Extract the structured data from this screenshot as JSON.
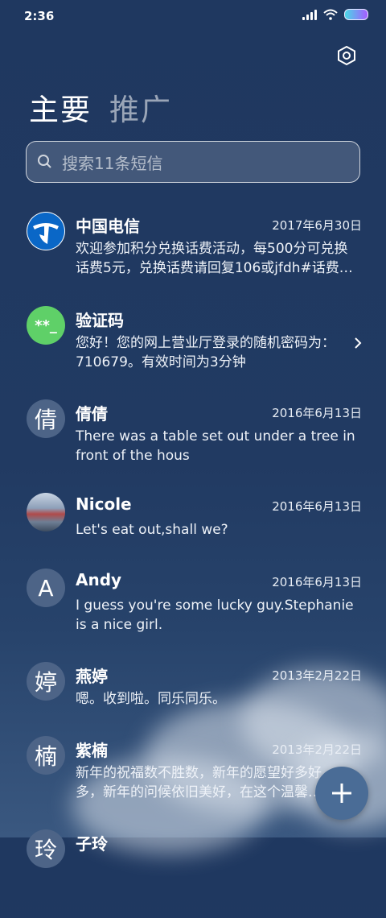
{
  "status": {
    "time": "2:36"
  },
  "tabs": {
    "primary": "主要",
    "promotions": "推广"
  },
  "search": {
    "placeholder": "搜索11条短信"
  },
  "messages": [
    {
      "name": "中国电信",
      "date": "2017年6月30日",
      "preview": "欢迎参加积分兑换话费活动，每500分可兑换话费5元，兑换话费请回复106或jfdh#话费…",
      "avatar": "china-telecom-logo"
    },
    {
      "name": "验证码",
      "date": "",
      "preview": "您好！您的网上营业厅登录的随机密码为：710679。有效时间为3分钟",
      "avatar_text": "**_"
    },
    {
      "name": "倩倩",
      "date": "2016年6月13日",
      "preview": "There was a table set out under a tree in front of the hous",
      "avatar_text": "倩"
    },
    {
      "name": "Nicole",
      "date": "2016年6月13日",
      "preview": "Let's eat out,shall we?",
      "avatar": "photo"
    },
    {
      "name": "Andy",
      "date": "2016年6月13日",
      "preview": "I guess you're some lucky guy.Stephanie is a nice girl.",
      "avatar_text": "A"
    },
    {
      "name": "燕婷",
      "date": "2013年2月22日",
      "preview": "嗯。收到啦。同乐同乐。",
      "avatar_text": "婷"
    },
    {
      "name": "紫楠",
      "date": "2013年2月22日",
      "preview": "新年的祝福数不胜数，新年的愿望好多好多，新年的问候依旧美好，在这个温馨的时刻",
      "avatar_text": "楠"
    },
    {
      "name": "子玲",
      "date": "",
      "preview": "",
      "avatar_text": "玲"
    }
  ],
  "colors": {
    "background": "#213a62",
    "verify_avatar": "#5fd068",
    "fab": "#4a6c96"
  }
}
